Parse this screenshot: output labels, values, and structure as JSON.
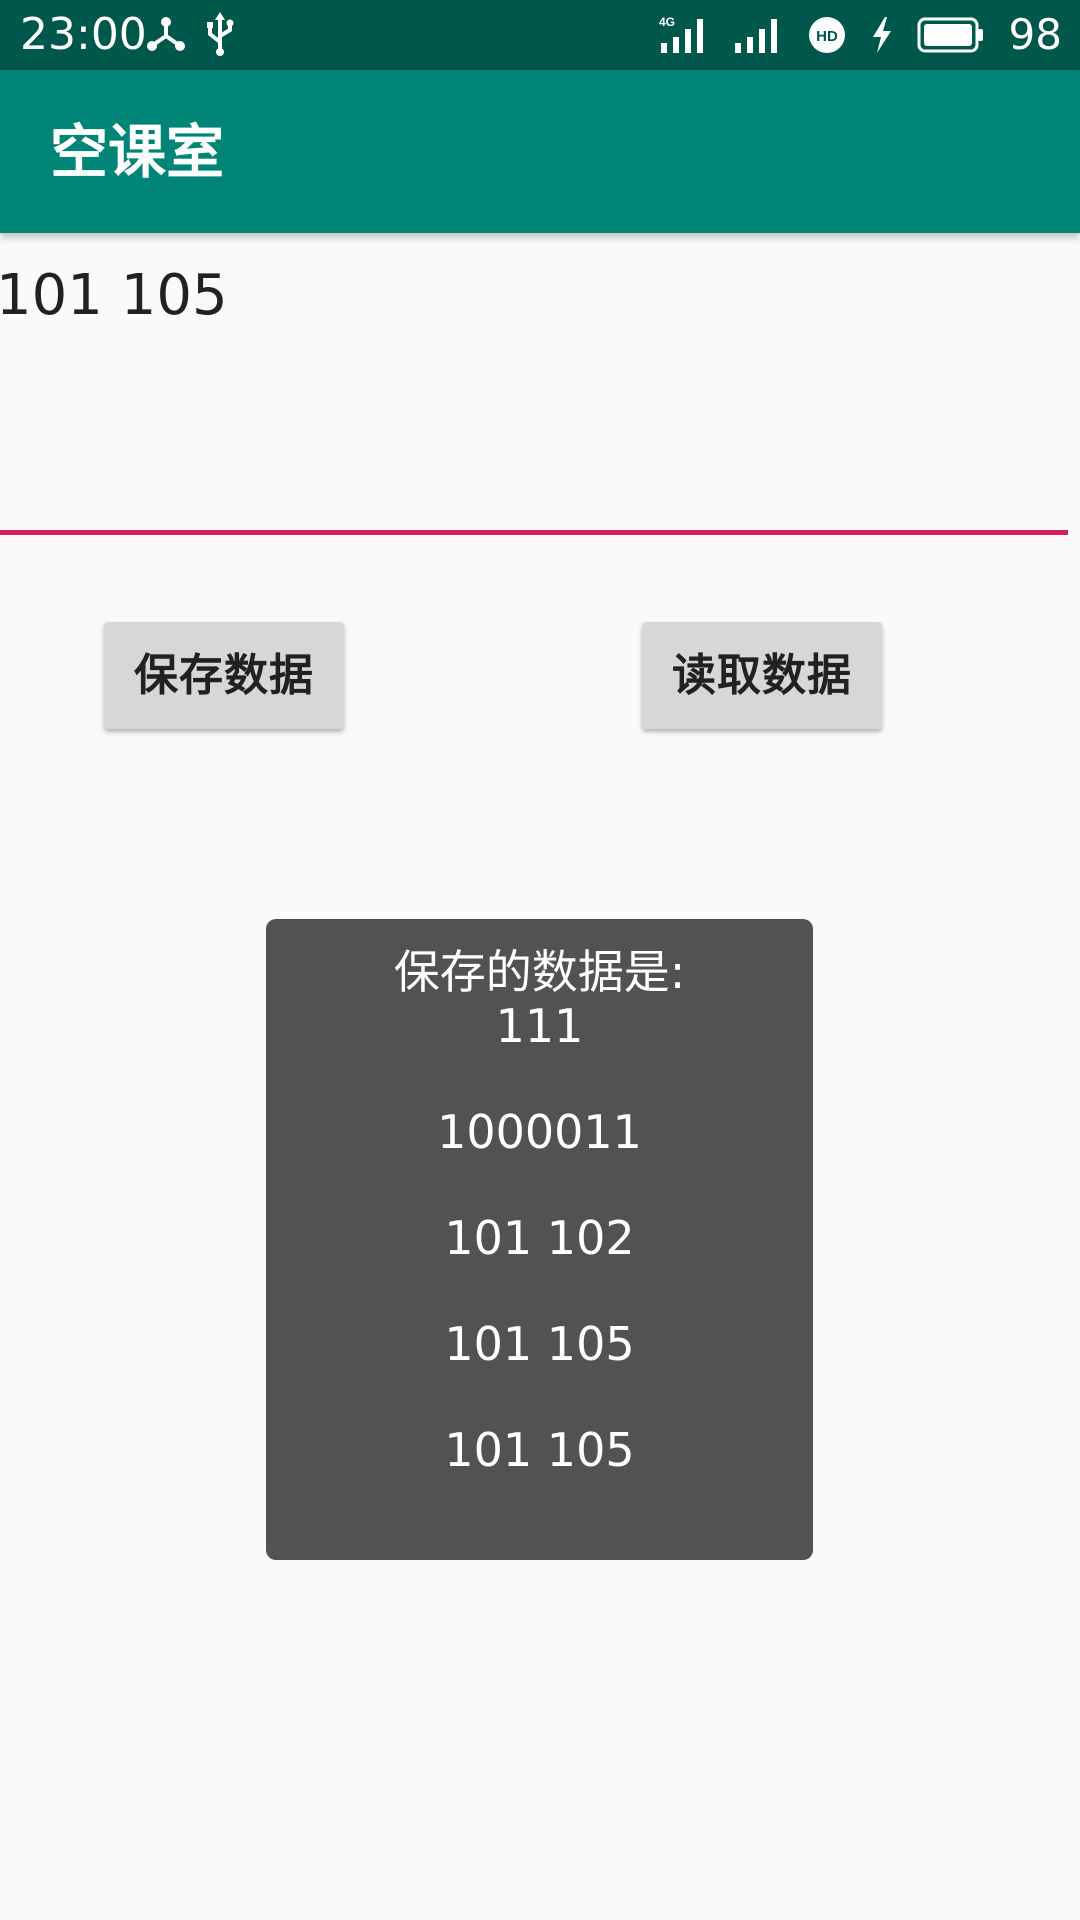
{
  "status_bar": {
    "time": "23:00",
    "battery": "98",
    "icons": [
      "usb-share-icon",
      "usb-icon",
      "signal-4g-icon",
      "signal-icon",
      "hd-icon",
      "charging-icon",
      "battery-icon"
    ],
    "network_label": "4G",
    "hd_label": "HD",
    "background_color": "#00574b"
  },
  "app_bar": {
    "title": "空课室",
    "background_color": "#008577"
  },
  "edit_field": {
    "value": "101 105",
    "underline_color": "#d81b60"
  },
  "buttons": {
    "save_label": "保存数据",
    "read_label": "读取数据"
  },
  "toast": {
    "header": "保存的数据是:",
    "lines": [
      "111",
      "1000011",
      "101 102",
      "101 105",
      "101 105"
    ]
  }
}
